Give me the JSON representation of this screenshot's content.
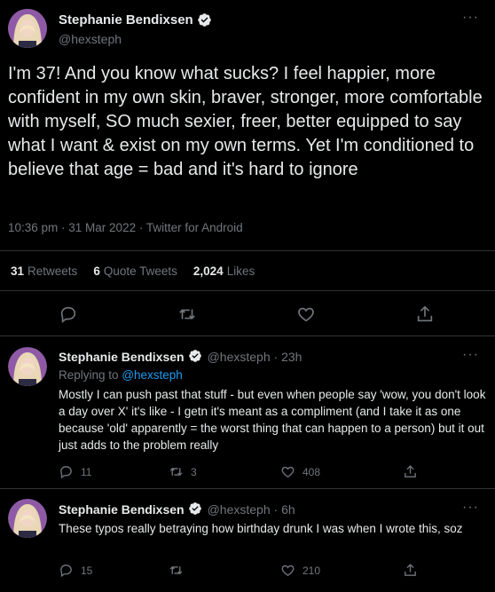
{
  "main_tweet": {
    "author_name": "Stephanie Bendixsen",
    "handle": "@hexsteph",
    "text": "I'm 37! And you know what sucks? I feel happier, more confident in my own skin, braver, stronger, more comfortable with myself, SO much sexier, freer, better equipped to say what I want & exist on my own terms. Yet I'm conditioned to believe that age = bad and it's hard to ignore",
    "meta": "10:36 pm · 31 Mar 2022 · Twitter for Android",
    "stats": {
      "retweets_count": "31",
      "retweets_label": "Retweets",
      "quotes_count": "6",
      "quotes_label": "Quote Tweets",
      "likes_count": "2,024",
      "likes_label": "Likes"
    },
    "more_label": "···"
  },
  "replies": [
    {
      "author_name": "Stephanie Bendixsen",
      "handle_time": "@hexsteph · 23h",
      "replying_prefix": "Replying to",
      "replying_handle": "@hexsteph",
      "text": "Mostly I can push past that stuff - but even when people say 'wow, you don't look a day over X' it's like - I getn it's meant as a compliment (and I take it as one because 'old' apparently = the worst thing that can happen to a person) but it out just adds to the problem really",
      "reply_count": "11",
      "retweet_count": "3",
      "like_count": "408",
      "more_label": "···"
    },
    {
      "author_name": "Stephanie Bendixsen",
      "handle_time": "@hexsteph · 6h",
      "text": "These typos really betraying how birthday drunk I was when I wrote this, soz",
      "reply_count": "15",
      "retweet_count": "",
      "like_count": "210",
      "more_label": "···"
    }
  ],
  "colors": {
    "background": "#000000",
    "text": "#e7e9ea",
    "muted": "#71767b",
    "accent": "#1d9bf0",
    "divider": "#2f3336"
  }
}
